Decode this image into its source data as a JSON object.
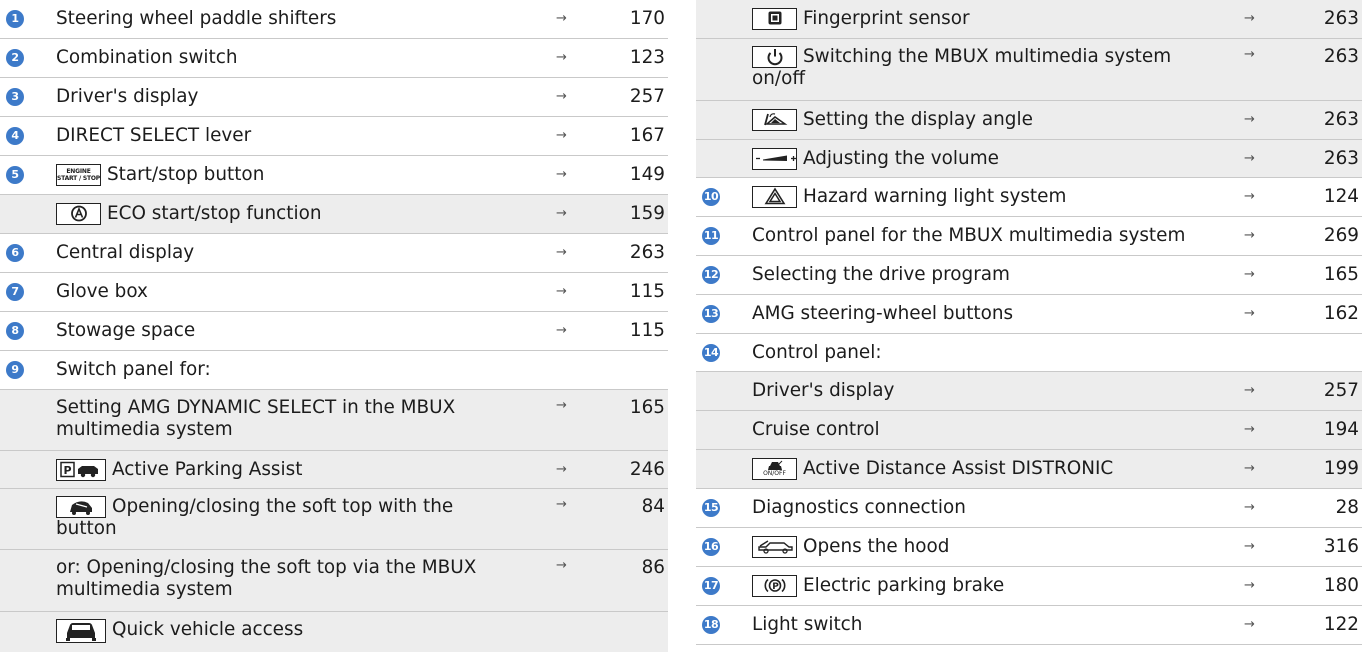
{
  "arrow": "→",
  "left": [
    {
      "num": "1",
      "label": "Steering wheel paddle shifters",
      "page": "170"
    },
    {
      "num": "2",
      "label": "Combination switch",
      "page": "123"
    },
    {
      "num": "3",
      "label": "Driver's display",
      "page": "257"
    },
    {
      "num": "4",
      "label": "DIRECT SELECT lever",
      "page": "167"
    },
    {
      "num": "5",
      "icon": "engine-start-stop-button-icon",
      "icon_text": "ENGINE START / STOP",
      "label": "Start/stop button",
      "page": "149"
    },
    {
      "icon": "eco-start-stop-icon",
      "label": "ECO start/stop function",
      "page": "159"
    },
    {
      "num": "6",
      "label": "Central display",
      "page": "263"
    },
    {
      "num": "7",
      "label": "Glove box",
      "page": "115"
    },
    {
      "num": "8",
      "label": "Stowage space",
      "page": "115"
    },
    {
      "num": "9",
      "label": "Switch panel for:"
    },
    {
      "label": "Setting AMG DYNAMIC SELECT in the MBUX multimedia system",
      "page": "165"
    },
    {
      "icon": "active-parking-assist-icon",
      "label": "Active Parking Assist",
      "page": "246"
    },
    {
      "icon": "soft-top-icon",
      "label": "Opening/closing the soft top with the button",
      "page": "84"
    },
    {
      "label": "or: Opening/closing the soft top via the MBUX multimedia system",
      "page": "86"
    },
    {
      "icon": "quick-vehicle-access-icon",
      "label": "Quick vehicle access"
    }
  ],
  "right": [
    {
      "icon": "fingerprint-sensor-icon",
      "label": "Fingerprint sensor",
      "page": "263"
    },
    {
      "icon": "power-icon",
      "label": "Switching the MBUX multimedia system on/off",
      "page": "263"
    },
    {
      "icon": "display-angle-icon",
      "label": "Setting the display angle",
      "page": "263"
    },
    {
      "icon": "volume-icon",
      "label": "Adjusting the volume",
      "page": "263"
    },
    {
      "num": "10",
      "icon": "hazard-warning-icon",
      "label": "Hazard warning light system",
      "page": "124"
    },
    {
      "num": "11",
      "label": "Control panel for the MBUX multimedia system",
      "page": "269"
    },
    {
      "num": "12",
      "label": "Selecting the drive program",
      "page": "165"
    },
    {
      "num": "13",
      "label": "AMG steering-wheel buttons",
      "page": "162"
    },
    {
      "num": "14",
      "label": "Control panel:"
    },
    {
      "label": "Driver's display",
      "page": "257"
    },
    {
      "label": "Cruise control",
      "page": "194"
    },
    {
      "icon": "distronic-icon",
      "icon_text": "ON/OFF",
      "label": "Active Distance Assist DISTRONIC",
      "page": "199"
    },
    {
      "num": "15",
      "label": "Diagnostics connection",
      "page": "28"
    },
    {
      "num": "16",
      "icon": "hood-icon",
      "label": "Opens the hood",
      "page": "316"
    },
    {
      "num": "17",
      "icon": "parking-brake-icon",
      "label": "Electric parking brake",
      "page": "180"
    },
    {
      "num": "18",
      "label": "Light switch",
      "page": "122"
    }
  ]
}
